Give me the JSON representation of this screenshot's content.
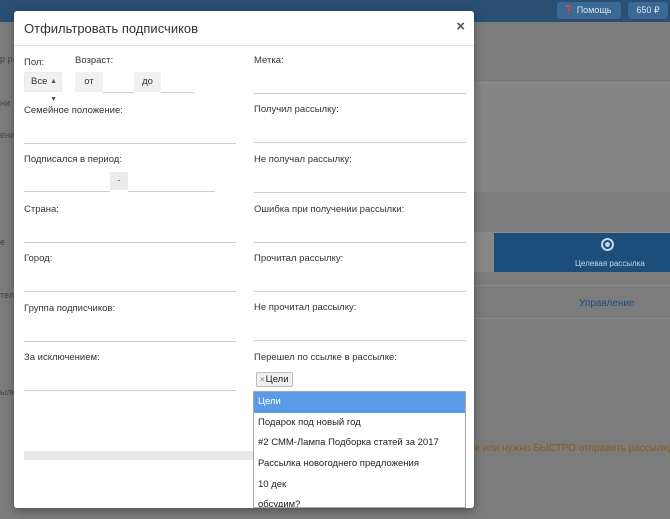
{
  "background": {
    "help_label": "❓ Помощь",
    "balance": "650 ₽",
    "target_label": "Целевая рассылка",
    "manage_label": "Управление",
    "orange_text": "и или нужно БЫСТРО отправить рассылку",
    "left_fragments": [
      "р ра",
      "ни",
      "ени",
      "е",
      "тел",
      "ылк"
    ]
  },
  "modal": {
    "title": "Отфильтровать подписчиков",
    "close": "×",
    "left": {
      "gender_label": "Пол:",
      "gender_value": "Все",
      "age_label": "Возраст:",
      "age_from": "от",
      "age_to": "до",
      "marital_label": "Семейное положение:",
      "subscribed_label": "Подписался в период:",
      "period_dash": "-",
      "country_label": "Страна:",
      "city_label": "Город:",
      "group_label": "Группа подписчиков:",
      "except_label": "За исключением:"
    },
    "right": {
      "tag_label": "Метка:",
      "received_label": "Получил рассылку:",
      "not_received_label": "Не получал рассылку:",
      "error_label": "Ошибка при получении рассылки:",
      "read_label": "Прочитал рассылку:",
      "not_read_label": "Не прочитал рассылку:",
      "clicked_label": "Перешел по ссылке в рассылке:",
      "selected_tag": "Цели",
      "dropdown_items": [
        "Цели",
        "Подарок под новый год",
        "#2 СММ-Лампа Подборка статей за 2017",
        "Рассылка новогоднего предложения",
        "10 дек",
        "обсудим?"
      ]
    }
  }
}
